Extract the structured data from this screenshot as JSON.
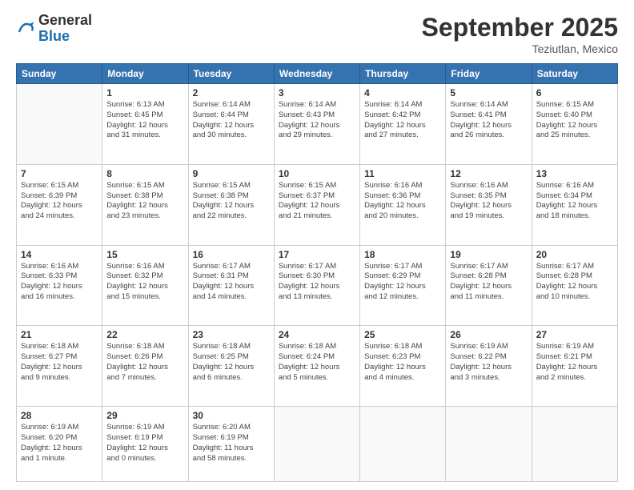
{
  "logo": {
    "general": "General",
    "blue": "Blue"
  },
  "header": {
    "month": "September 2025",
    "location": "Teziutlan, Mexico"
  },
  "days_of_week": [
    "Sunday",
    "Monday",
    "Tuesday",
    "Wednesday",
    "Thursday",
    "Friday",
    "Saturday"
  ],
  "weeks": [
    [
      {
        "num": "",
        "info": ""
      },
      {
        "num": "1",
        "info": "Sunrise: 6:13 AM\nSunset: 6:45 PM\nDaylight: 12 hours\nand 31 minutes."
      },
      {
        "num": "2",
        "info": "Sunrise: 6:14 AM\nSunset: 6:44 PM\nDaylight: 12 hours\nand 30 minutes."
      },
      {
        "num": "3",
        "info": "Sunrise: 6:14 AM\nSunset: 6:43 PM\nDaylight: 12 hours\nand 29 minutes."
      },
      {
        "num": "4",
        "info": "Sunrise: 6:14 AM\nSunset: 6:42 PM\nDaylight: 12 hours\nand 27 minutes."
      },
      {
        "num": "5",
        "info": "Sunrise: 6:14 AM\nSunset: 6:41 PM\nDaylight: 12 hours\nand 26 minutes."
      },
      {
        "num": "6",
        "info": "Sunrise: 6:15 AM\nSunset: 6:40 PM\nDaylight: 12 hours\nand 25 minutes."
      }
    ],
    [
      {
        "num": "7",
        "info": "Sunrise: 6:15 AM\nSunset: 6:39 PM\nDaylight: 12 hours\nand 24 minutes."
      },
      {
        "num": "8",
        "info": "Sunrise: 6:15 AM\nSunset: 6:38 PM\nDaylight: 12 hours\nand 23 minutes."
      },
      {
        "num": "9",
        "info": "Sunrise: 6:15 AM\nSunset: 6:38 PM\nDaylight: 12 hours\nand 22 minutes."
      },
      {
        "num": "10",
        "info": "Sunrise: 6:15 AM\nSunset: 6:37 PM\nDaylight: 12 hours\nand 21 minutes."
      },
      {
        "num": "11",
        "info": "Sunrise: 6:16 AM\nSunset: 6:36 PM\nDaylight: 12 hours\nand 20 minutes."
      },
      {
        "num": "12",
        "info": "Sunrise: 6:16 AM\nSunset: 6:35 PM\nDaylight: 12 hours\nand 19 minutes."
      },
      {
        "num": "13",
        "info": "Sunrise: 6:16 AM\nSunset: 6:34 PM\nDaylight: 12 hours\nand 18 minutes."
      }
    ],
    [
      {
        "num": "14",
        "info": "Sunrise: 6:16 AM\nSunset: 6:33 PM\nDaylight: 12 hours\nand 16 minutes."
      },
      {
        "num": "15",
        "info": "Sunrise: 6:16 AM\nSunset: 6:32 PM\nDaylight: 12 hours\nand 15 minutes."
      },
      {
        "num": "16",
        "info": "Sunrise: 6:17 AM\nSunset: 6:31 PM\nDaylight: 12 hours\nand 14 minutes."
      },
      {
        "num": "17",
        "info": "Sunrise: 6:17 AM\nSunset: 6:30 PM\nDaylight: 12 hours\nand 13 minutes."
      },
      {
        "num": "18",
        "info": "Sunrise: 6:17 AM\nSunset: 6:29 PM\nDaylight: 12 hours\nand 12 minutes."
      },
      {
        "num": "19",
        "info": "Sunrise: 6:17 AM\nSunset: 6:28 PM\nDaylight: 12 hours\nand 11 minutes."
      },
      {
        "num": "20",
        "info": "Sunrise: 6:17 AM\nSunset: 6:28 PM\nDaylight: 12 hours\nand 10 minutes."
      }
    ],
    [
      {
        "num": "21",
        "info": "Sunrise: 6:18 AM\nSunset: 6:27 PM\nDaylight: 12 hours\nand 9 minutes."
      },
      {
        "num": "22",
        "info": "Sunrise: 6:18 AM\nSunset: 6:26 PM\nDaylight: 12 hours\nand 7 minutes."
      },
      {
        "num": "23",
        "info": "Sunrise: 6:18 AM\nSunset: 6:25 PM\nDaylight: 12 hours\nand 6 minutes."
      },
      {
        "num": "24",
        "info": "Sunrise: 6:18 AM\nSunset: 6:24 PM\nDaylight: 12 hours\nand 5 minutes."
      },
      {
        "num": "25",
        "info": "Sunrise: 6:18 AM\nSunset: 6:23 PM\nDaylight: 12 hours\nand 4 minutes."
      },
      {
        "num": "26",
        "info": "Sunrise: 6:19 AM\nSunset: 6:22 PM\nDaylight: 12 hours\nand 3 minutes."
      },
      {
        "num": "27",
        "info": "Sunrise: 6:19 AM\nSunset: 6:21 PM\nDaylight: 12 hours\nand 2 minutes."
      }
    ],
    [
      {
        "num": "28",
        "info": "Sunrise: 6:19 AM\nSunset: 6:20 PM\nDaylight: 12 hours\nand 1 minute."
      },
      {
        "num": "29",
        "info": "Sunrise: 6:19 AM\nSunset: 6:19 PM\nDaylight: 12 hours\nand 0 minutes."
      },
      {
        "num": "30",
        "info": "Sunrise: 6:20 AM\nSunset: 6:19 PM\nDaylight: 11 hours\nand 58 minutes."
      },
      {
        "num": "",
        "info": ""
      },
      {
        "num": "",
        "info": ""
      },
      {
        "num": "",
        "info": ""
      },
      {
        "num": "",
        "info": ""
      }
    ]
  ]
}
